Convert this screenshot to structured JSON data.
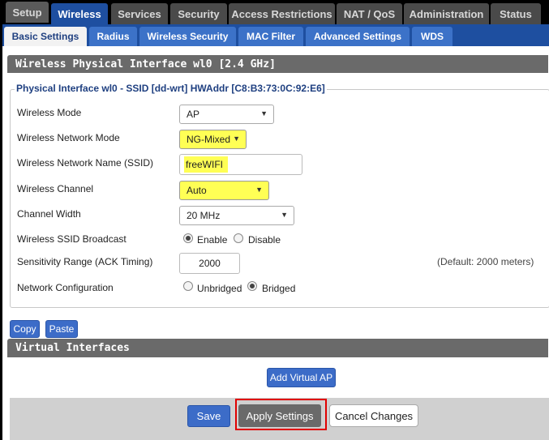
{
  "top_tabs": [
    {
      "label": "Setup"
    },
    {
      "label": "Wireless",
      "active": true
    },
    {
      "label": "Services"
    },
    {
      "label": "Security"
    },
    {
      "label": "Access Restrictions"
    },
    {
      "label": "NAT / QoS"
    },
    {
      "label": "Administration"
    },
    {
      "label": "Status"
    }
  ],
  "sub_tabs": [
    {
      "label": "Basic Settings",
      "active": true
    },
    {
      "label": "Radius"
    },
    {
      "label": "Wireless Security"
    },
    {
      "label": "MAC Filter"
    },
    {
      "label": "Advanced Settings"
    },
    {
      "label": "WDS"
    }
  ],
  "section_title": "Wireless Physical Interface wl0 [2.4 GHz]",
  "fieldset_legend": "Physical Interface wl0 - SSID [dd-wrt] HWAddr [C8:B3:73:0C:92:E6]",
  "fields": {
    "wireless_mode": {
      "label": "Wireless Mode",
      "value": "AP"
    },
    "network_mode": {
      "label": "Wireless Network Mode",
      "value": "NG-Mixed"
    },
    "ssid": {
      "label": "Wireless Network Name (SSID)",
      "value": "freeWIFI"
    },
    "channel": {
      "label": "Wireless Channel",
      "value": "Auto"
    },
    "channel_width": {
      "label": "Channel Width",
      "value": "20 MHz"
    },
    "ssid_broadcast": {
      "label": "Wireless SSID Broadcast",
      "option_enable": "Enable",
      "option_disable": "Disable",
      "selected": "Enable"
    },
    "sensitivity": {
      "label": "Sensitivity Range (ACK Timing)",
      "value": "2000",
      "note": "(Default: 2000 meters)"
    },
    "network_config": {
      "label": "Network Configuration",
      "option_unbridged": "Unbridged",
      "option_bridged": "Bridged",
      "selected": "Bridged"
    }
  },
  "copy_label": "Copy",
  "paste_label": "Paste",
  "virtual_title": "Virtual Interfaces",
  "add_vap_label": "Add Virtual AP",
  "footer": {
    "save_label": "Save",
    "apply_label": "Apply Settings",
    "cancel_label": "Cancel Changes"
  },
  "colors": {
    "tab_active": "#1e4fa0",
    "highlight": "#ffff55",
    "annotation_red": "#e00000"
  }
}
